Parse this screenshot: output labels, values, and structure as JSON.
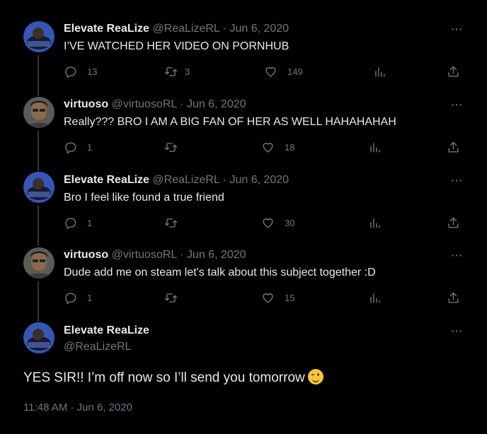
{
  "replies": [
    {
      "name": "Elevate ReaLize",
      "handle": "@ReaLizeRL",
      "date": "Jun 6, 2020",
      "text": "I’VE WATCHED HER VIDEO ON PORNHUB",
      "replies_count": "13",
      "retweets_count": "3",
      "likes_count": "149",
      "avatar": "elevate"
    },
    {
      "name": "virtuoso",
      "handle": "@virtuosoRL",
      "date": "Jun 6, 2020",
      "text": "Really???  BRO I AM A BIG FAN OF HER AS WELL HAHAHAHAH",
      "replies_count": "1",
      "retweets_count": "",
      "likes_count": "18",
      "avatar": "virtuoso"
    },
    {
      "name": "Elevate ReaLize",
      "handle": "@ReaLizeRL",
      "date": "Jun 6, 2020",
      "text": "Bro I feel like found a true friend",
      "replies_count": "1",
      "retweets_count": "",
      "likes_count": "30",
      "avatar": "elevate"
    },
    {
      "name": "virtuoso",
      "handle": "@virtuosoRL",
      "date": "Jun 6, 2020",
      "text": "Dude add me on steam let's talk about this subject together :D",
      "replies_count": "1",
      "retweets_count": "",
      "likes_count": "15",
      "avatar": "virtuoso"
    }
  ],
  "main_tweet": {
    "name": "Elevate ReaLize",
    "handle": "@ReaLizeRL",
    "text": "YES SIR!! I’m off now so I’ll send you tomorrow",
    "emoji": "winking-face",
    "timestamp": "11:48 AM · Jun 6, 2020"
  },
  "separator": "·",
  "more_label": "···",
  "colors": {
    "background": "#000000",
    "text": "#e7e9ea",
    "muted": "#71767b",
    "thread_line": "#333639"
  },
  "icons": [
    "reply-icon",
    "retweet-icon",
    "like-icon",
    "views-icon",
    "share-icon",
    "more-icon"
  ]
}
